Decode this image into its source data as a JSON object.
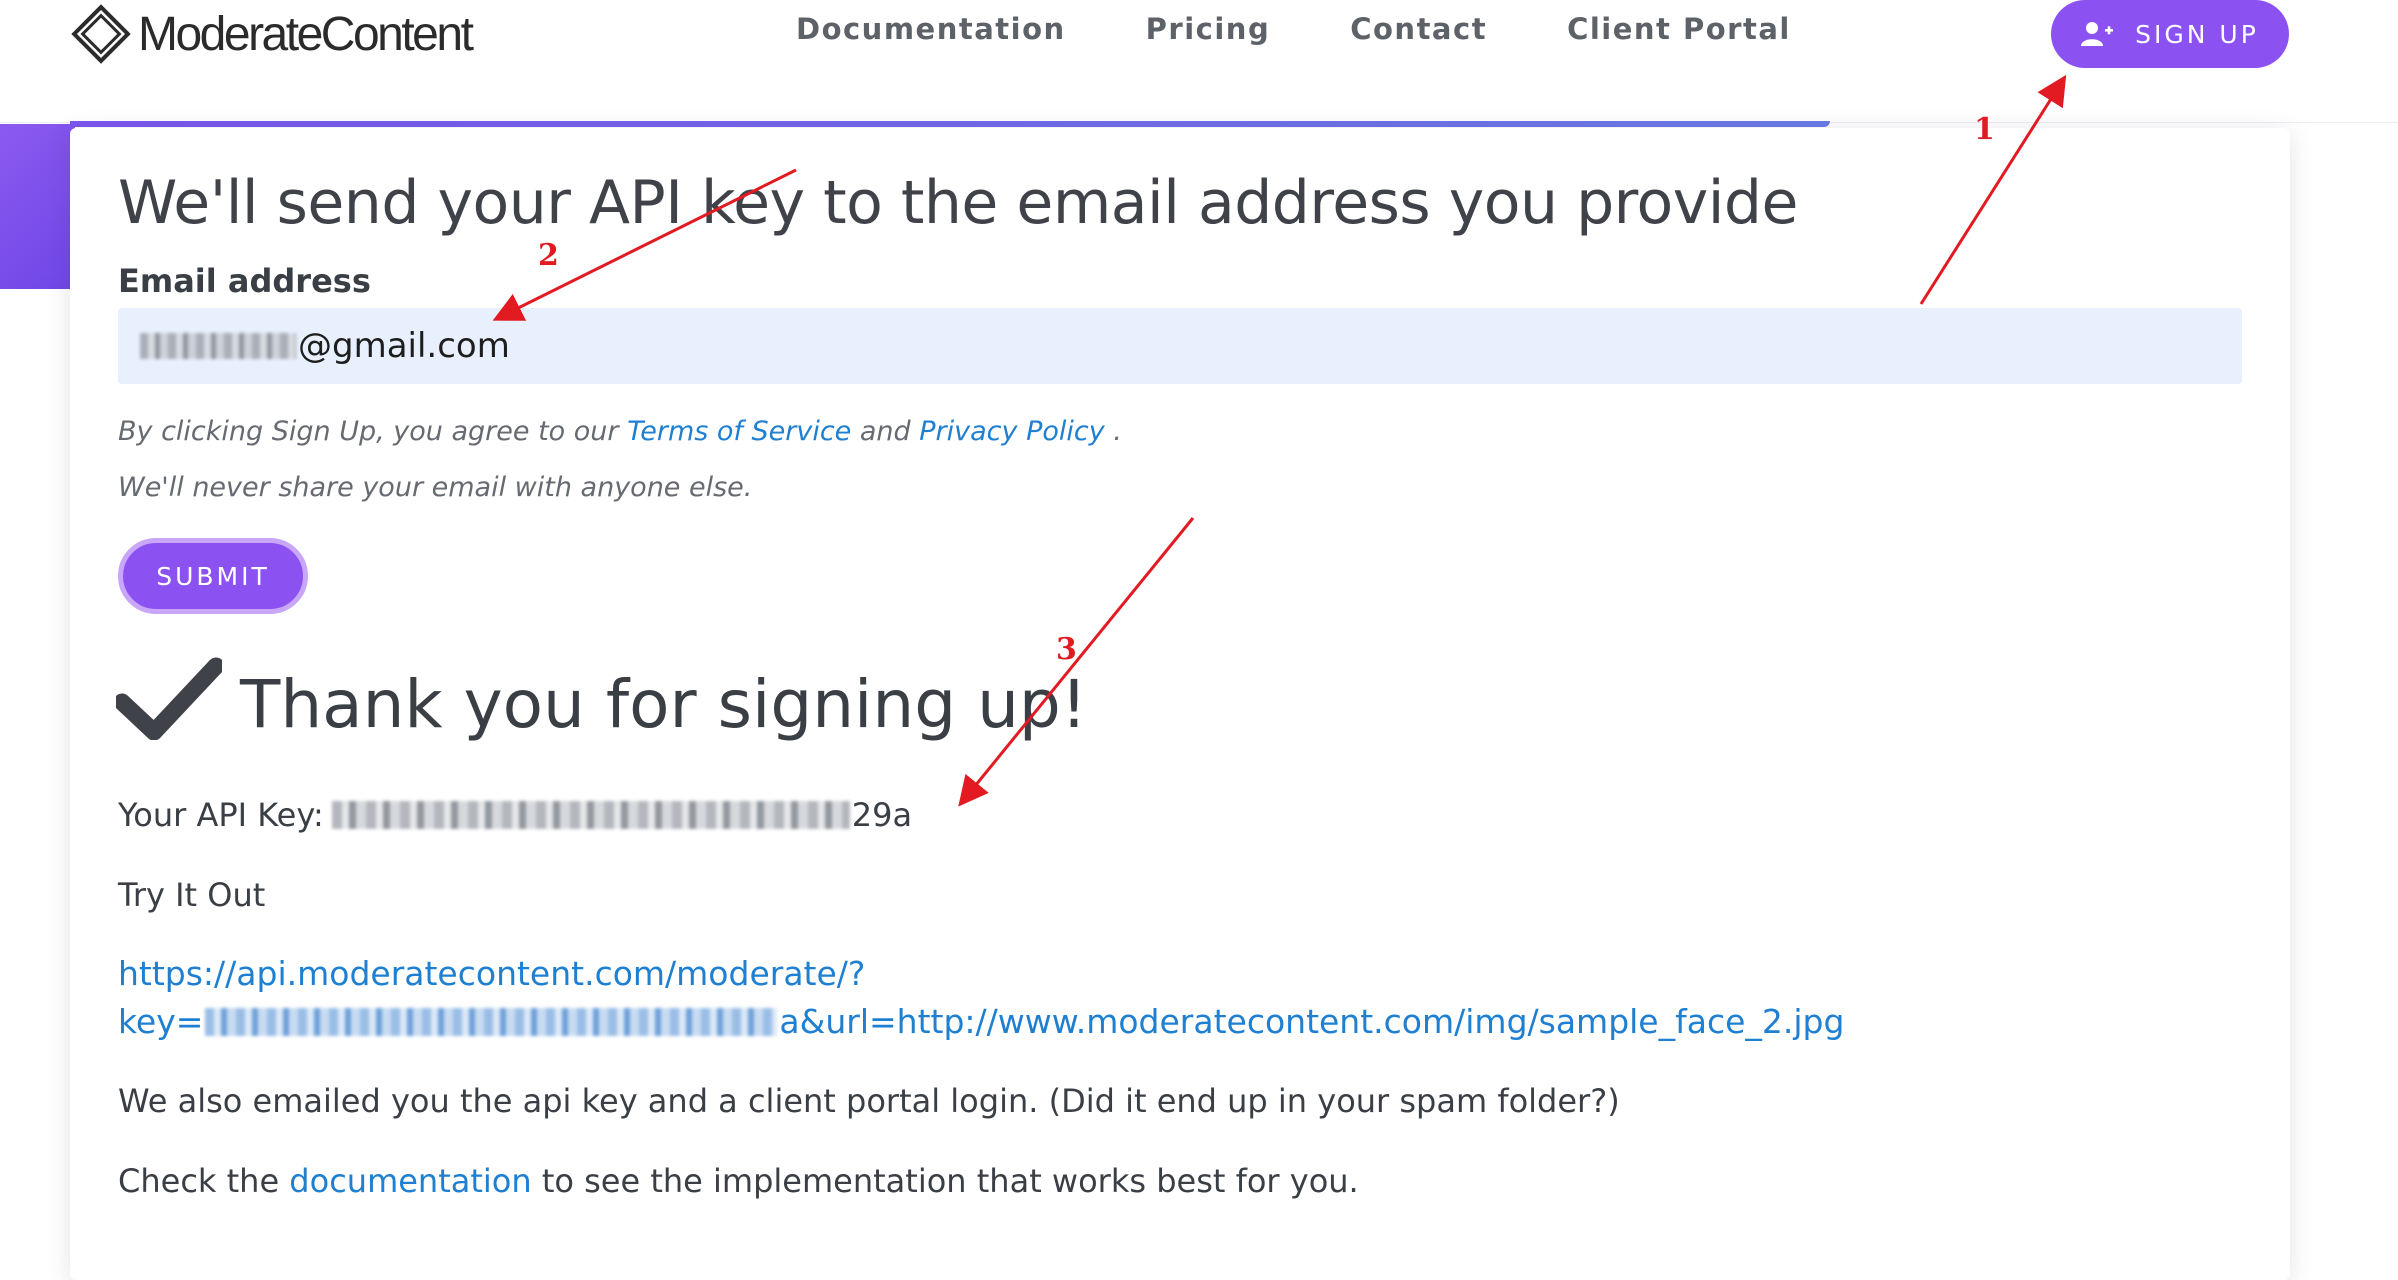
{
  "header": {
    "logo_text": "ModerateContent",
    "nav": [
      "Documentation",
      "Pricing",
      "Contact",
      "Client Portal"
    ],
    "signup_label": "SIGN UP"
  },
  "form": {
    "title": "We'll send your API key to the email address you provide",
    "email_label": "Email address",
    "email_value_suffix": "@gmail.com",
    "terms_prefix": "By clicking Sign Up, you agree to our ",
    "terms_link": "Terms of Service",
    "terms_and": " and ",
    "privacy_link": "Privacy Policy",
    "terms_suffix": " .",
    "never_share": "We'll never share your email with anyone else.",
    "submit_label": "SUBMIT"
  },
  "result": {
    "thanks": "Thank you for signing up!",
    "api_key_label": "Your API Key: ",
    "api_key_suffix": "29a",
    "try_it": "Try It Out",
    "url_line1": "https://api.moderatecontent.com/moderate/?",
    "url_line2_prefix": "key=",
    "url_line2_suffix": "a&url=http://www.moderatecontent.com/img/sample_face_2.jpg",
    "emailed": "We also emailed you the api key and a client portal login. (Did it end up in your spam folder?)",
    "doc_prefix": "Check the ",
    "doc_link": "documentation",
    "doc_suffix": " to see the implementation that works best for you."
  },
  "annotations": [
    "1",
    "2",
    "3"
  ],
  "colors": {
    "accent": "#8c52f1",
    "link": "#1f7fd1",
    "annotation": "#e21a22"
  }
}
